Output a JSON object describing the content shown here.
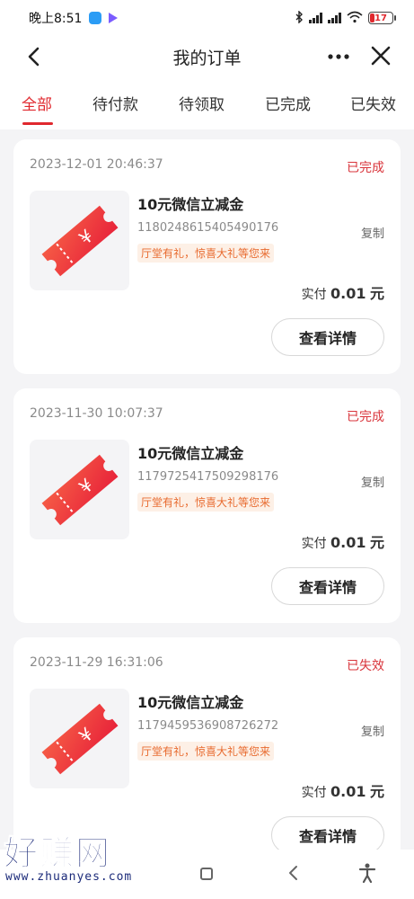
{
  "status_bar": {
    "time": "晚上8:51",
    "battery": "17"
  },
  "nav": {
    "title": "我的订单",
    "back_icon": "back-arrow-icon",
    "more_icon": "more-dots-icon",
    "close_icon": "close-icon"
  },
  "tabs": [
    {
      "label": "全部",
      "active": true
    },
    {
      "label": "待付款",
      "active": false
    },
    {
      "label": "待领取",
      "active": false
    },
    {
      "label": "已完成",
      "active": false
    },
    {
      "label": "已失效",
      "active": false
    }
  ],
  "orders": [
    {
      "date": "2023-12-01 20:46:37",
      "status": "已完成",
      "name": "10元微信立减金",
      "order_no": "1180248615405490176",
      "copy_label": "复制",
      "promo": "厅堂有礼，惊喜大礼等您来",
      "paid_label": "实付",
      "paid_amount": "0.01",
      "paid_unit": "元",
      "button": "查看详情"
    },
    {
      "date": "2023-11-30 10:07:37",
      "status": "已完成",
      "name": "10元微信立减金",
      "order_no": "1179725417509298176",
      "copy_label": "复制",
      "promo": "厅堂有礼，惊喜大礼等您来",
      "paid_label": "实付",
      "paid_amount": "0.01",
      "paid_unit": "元",
      "button": "查看详情"
    },
    {
      "date": "2023-11-29 16:31:06",
      "status": "已失效",
      "name": "10元微信立减金",
      "order_no": "1179459536908726272",
      "copy_label": "复制",
      "promo": "厅堂有礼，惊喜大礼等您来",
      "paid_label": "实付",
      "paid_amount": "0.01",
      "paid_unit": "元",
      "button": "查看详情"
    }
  ],
  "watermark": {
    "big": "好赚网",
    "small": "www.zhuanyes.com"
  },
  "colors": {
    "accent": "#e0282e",
    "status_red": "#d9343b",
    "promo_orange": "#e86a2e",
    "background": "#f4f4f6"
  }
}
